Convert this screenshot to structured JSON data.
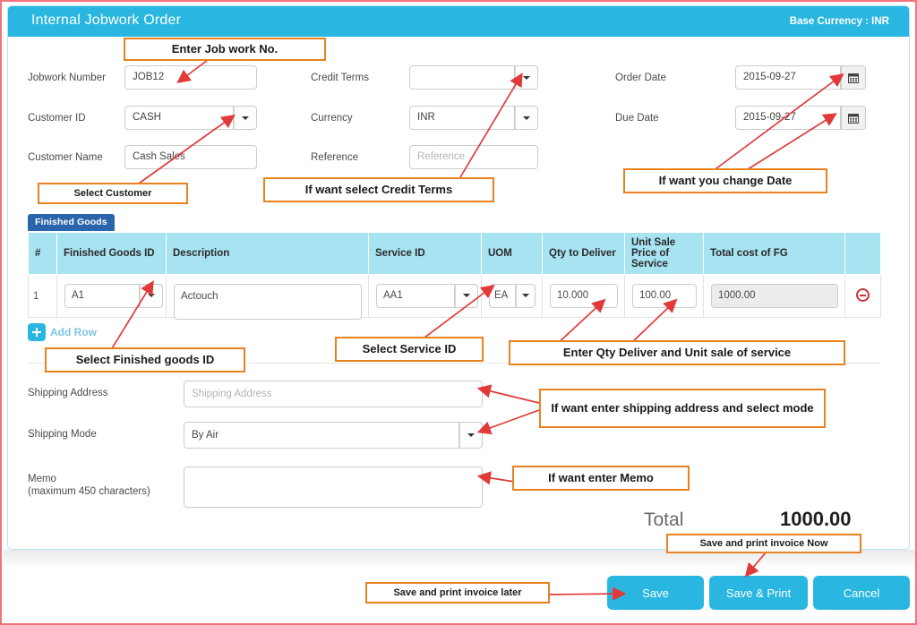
{
  "window": {
    "title": "Internal Jobwork Order",
    "base_currency_label": "Base Currency : INR",
    "accent_color": "#29b6e0",
    "annotation_color": "#e8821e",
    "arrow_color": "#e03a3a",
    "border_color": "#f4737a"
  },
  "form": {
    "left": [
      {
        "label": "Jobwork Number",
        "value": "JOB12",
        "type": "text",
        "name": "jobwork-number"
      },
      {
        "label": "Customer ID",
        "value": "CASH",
        "type": "select",
        "name": "customer-id"
      },
      {
        "label": "Customer Name",
        "value": "Cash Sales",
        "type": "text",
        "name": "customer-name"
      }
    ],
    "middle": [
      {
        "label": "Credit Terms",
        "value": "",
        "type": "select",
        "name": "credit-terms"
      },
      {
        "label": "Currency",
        "value": "INR",
        "type": "select",
        "name": "currency"
      },
      {
        "label": "Reference",
        "value": "",
        "placeholder": "Reference",
        "type": "text",
        "name": "reference"
      }
    ],
    "right": [
      {
        "label": "Order Date",
        "value": "2015-09-27",
        "type": "date",
        "name": "order-date"
      },
      {
        "label": "Due Date",
        "value": "2015-09-27",
        "type": "date",
        "name": "due-date"
      }
    ]
  },
  "items_section": {
    "tab_label": "Finished Goods",
    "columns": [
      "#",
      "Finished Goods ID",
      "Description",
      "Service ID",
      "UOM",
      "Qty to Deliver",
      "Unit Sale Price of Service",
      "Total cost of FG",
      ""
    ],
    "rows": [
      {
        "index": "1",
        "finished_goods_id": "A1",
        "description": "Actouch",
        "service_id": "AA1",
        "uom": "EA",
        "qty_to_deliver": "10.000",
        "unit_sale_price": "100.00",
        "total_cost_fg": "1000.00"
      }
    ],
    "add_row_label": "Add Row"
  },
  "shipping": {
    "address_label": "Shipping Address",
    "address_value": "",
    "address_placeholder": "Shipping Address",
    "mode_label": "Shipping Mode",
    "mode_value": "By Air"
  },
  "memo": {
    "label_line1": "Memo",
    "label_line2": "(maximum 450 characters)",
    "value": ""
  },
  "totals": {
    "label": "Total",
    "value": "1000.00"
  },
  "buttons": {
    "save": "Save",
    "save_print": "Save & Print",
    "cancel": "Cancel"
  },
  "annotations": [
    {
      "id": "a1",
      "text": "Enter Job work No."
    },
    {
      "id": "a2",
      "text": "Select Customer"
    },
    {
      "id": "a3",
      "text": "If want select Credit Terms"
    },
    {
      "id": "a4",
      "text": "If want you change Date"
    },
    {
      "id": "a5",
      "text": "Select Finished goods ID"
    },
    {
      "id": "a6",
      "text": "Select Service ID"
    },
    {
      "id": "a7",
      "text": "Enter Qty Deliver and Unit sale of service"
    },
    {
      "id": "a8",
      "text": "If want enter shipping address and select mode"
    },
    {
      "id": "a9",
      "text": "If want enter Memo"
    },
    {
      "id": "a10",
      "text": "Save and print invoice Now"
    },
    {
      "id": "a11",
      "text": "Save and print invoice later"
    }
  ]
}
